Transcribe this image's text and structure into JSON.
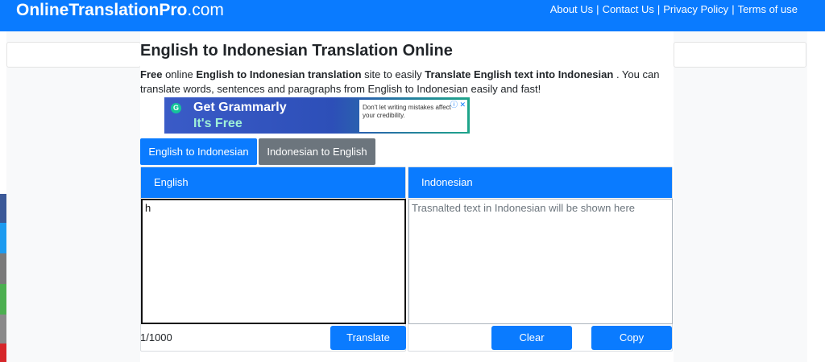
{
  "header": {
    "brand_main": "OnlineTranslationPro",
    "brand_suffix": ".com",
    "nav": [
      "About Us",
      "Contact Us",
      "Privacy Policy",
      "Terms of use"
    ],
    "nav_separator": "|"
  },
  "page": {
    "title": "English to Indonesian Translation Online",
    "intro_parts": [
      "Free",
      " online ",
      "English to Indonesian translation",
      " site to easily ",
      "Translate English text into Indonesian",
      " . You can translate words, sentences and paragraphs from English to Indonesian easily and fast!"
    ]
  },
  "ad": {
    "logo": "G",
    "headline": "Get Grammarly",
    "subline": "It's Free",
    "note": "Don't let writing mistakes affect your credibility.",
    "close": "ⓘ ✕"
  },
  "tabs": [
    {
      "label": "English to Indonesian",
      "active": true
    },
    {
      "label": "Indonesian to English",
      "active": false
    }
  ],
  "source_panel": {
    "header": "English",
    "value": "h"
  },
  "target_panel": {
    "header": "Indonesian",
    "placeholder": "Trasnalted text in Indonesian will be shown here"
  },
  "controls": {
    "counter": "1/1000",
    "translate_label": "Translate",
    "clear_label": "Clear",
    "copy_label": "Copy"
  },
  "colors": {
    "primary": "#0a7bff",
    "tab_inactive": "#6c757d"
  }
}
